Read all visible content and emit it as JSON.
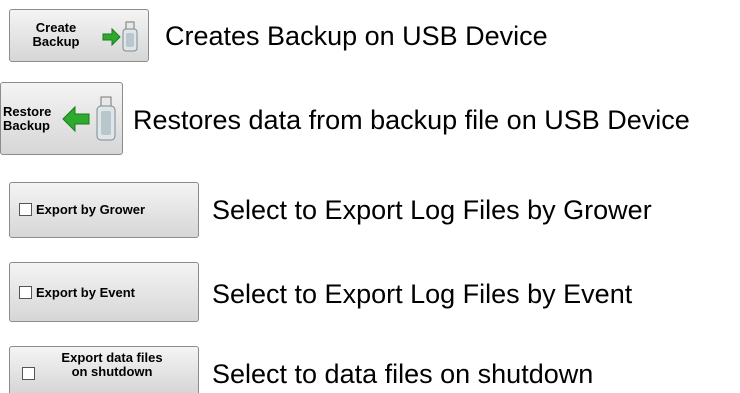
{
  "create_backup": {
    "label_line1": "Create",
    "label_line2": "Backup",
    "description": "Creates Backup on USB Device",
    "icon": "usb-backup-icon"
  },
  "restore_backup": {
    "label_line1": "Restore",
    "label_line2": "Backup",
    "description": "Restores data from backup file on USB Device",
    "icon": "usb-restore-icon"
  },
  "export_by_grower": {
    "label": "Export by Grower",
    "checked": false,
    "description": "Select to Export Log Files by Grower"
  },
  "export_by_event": {
    "label": "Export by Event",
    "checked": false,
    "description": "Select to Export Log Files by Event"
  },
  "export_on_shutdown": {
    "label_line1": "Export data files",
    "label_line2": "on shutdown",
    "checked": false,
    "description": "Select to data files on shutdown"
  },
  "colors": {
    "arrow": "#2eaa2e",
    "button_border": "#8c8c8c"
  }
}
